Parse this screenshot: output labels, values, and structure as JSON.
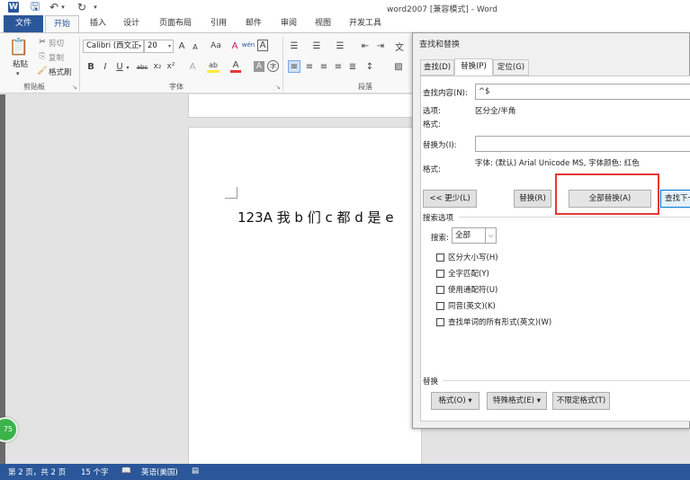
{
  "titlebar": {
    "app_icon": "W",
    "save_icon": "floppy-disk",
    "undo_icon": "undo-arrow",
    "redo_icon": "redo-arrow",
    "title": "word2007 [兼容模式] - Word"
  },
  "ribbon_tabs": [
    "文件",
    "开始",
    "插入",
    "设计",
    "页面布局",
    "引用",
    "邮件",
    "审阅",
    "视图",
    "开发工具"
  ],
  "clipboard": {
    "paste": "粘贴",
    "cut": "剪切",
    "copy": "复制",
    "format_painter": "格式刷",
    "group_label": "剪贴板"
  },
  "font": {
    "font_name": "Calibri (西文正",
    "font_size": "20",
    "grow": "A",
    "shrink": "A",
    "change_case": "Aa",
    "clear_format": "A",
    "phonetic": "wén",
    "border_char": "A",
    "bold": "B",
    "italic": "I",
    "underline": "U",
    "strike": "abc",
    "subscript": "x₂",
    "superscript": "x²",
    "text_effects": "A",
    "highlight": "ab",
    "font_color": "A",
    "char_shading": "A",
    "enclose_char": "字",
    "group_label": "字体"
  },
  "paragraph": {
    "group_label": "段落"
  },
  "document": {
    "text": "123A 我 b 们 c 都 d 是 e"
  },
  "badge": {
    "text": "75"
  },
  "statusbar": {
    "page": "第 2 页，共 2 页",
    "words": "15 个字",
    "language": "英语(美国)"
  },
  "dialog": {
    "title": "查找和替换",
    "tabs": [
      {
        "label": "查找(D)"
      },
      {
        "label": "替换(P)"
      },
      {
        "label": "定位(G)"
      }
    ],
    "find_label": "查找内容(N):",
    "find_value": "^$",
    "options_label": "选项:",
    "options_value": "区分全/半角",
    "format_label": "格式:",
    "replace_label": "替换为(I):",
    "replace_value": "",
    "replace_format_label": "格式:",
    "replace_format_value": "字体: (默认) Arial Unicode MS, 字体颜色: 红色",
    "less_button": "<< 更少(L)",
    "replace_button": "替换(R)",
    "replace_all_button": "全部替换(A)",
    "find_next_button": "查找下一处(F)",
    "search_options_label": "搜索选项",
    "search_label": "搜索:",
    "search_value": "全部",
    "checkboxes": [
      {
        "label": "区分大小写(H)",
        "checked": false
      },
      {
        "label": "全字匹配(Y)",
        "checked": false
      },
      {
        "label": "使用通配符(U)",
        "checked": false
      },
      {
        "label": "同音(英文)(K)",
        "checked": false
      },
      {
        "label": "查找单词的所有形式(英文)(W)",
        "checked": false
      }
    ],
    "replace_section_label": "替换",
    "format_button": "格式(O) ▾",
    "special_button": "特殊格式(E) ▾",
    "no_format_button": "不限定格式(T)"
  },
  "colors": {
    "accent": "#2b579a",
    "highlight_box": "#e53935"
  }
}
